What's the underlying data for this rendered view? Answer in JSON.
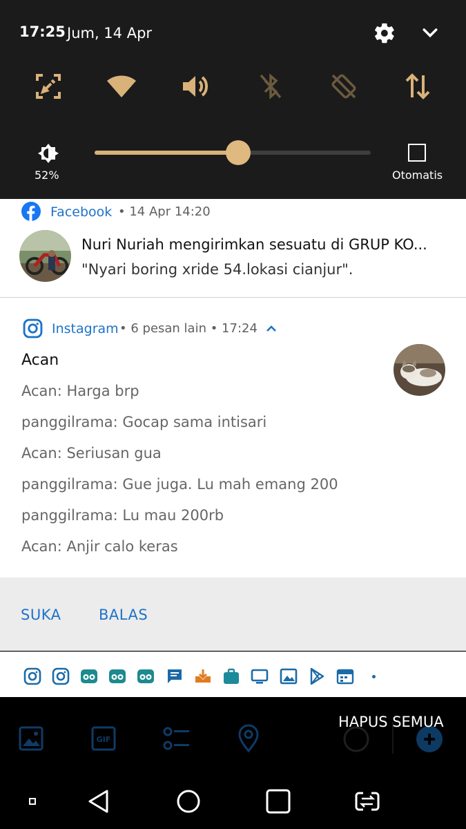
{
  "status": {
    "time": "17:25",
    "date": "Jum, 14 Apr"
  },
  "quick_settings": {
    "tiles": [
      "screenshot-edit",
      "wifi",
      "sound",
      "bluetooth-off",
      "auto-rotate-off",
      "mobile-data"
    ],
    "brightness_percent_label": "52%",
    "brightness_level": 0.52,
    "auto_label": "Otomatis",
    "accent_color": "#d9b27a"
  },
  "facebook": {
    "app": "Facebook",
    "meta": "• 14 Apr 14:20",
    "title": "Nuri Nuriah mengirimkan sesuatu di GRUP KO...",
    "text": "\"Nyari boring xride 54.lokasi cianjur\"."
  },
  "instagram": {
    "app": "Instagram",
    "meta": "• 6 pesan lain • 17:24",
    "sender": "Acan",
    "messages": [
      "Acan: Harga brp",
      "panggilrama: Gocap sama intisari",
      "Acan: Seriusan gua",
      "panggilrama: Gue juga. Lu mah emang 200",
      "panggilrama: Lu mau 200rb",
      "Acan: Anjir calo keras"
    ],
    "actions": {
      "like": "SUKA",
      "reply": "BALAS"
    }
  },
  "icon_strip": [
    "instagram",
    "instagram",
    "tripadvisor",
    "tripadvisor",
    "tripadvisor",
    "message",
    "download",
    "briefcase",
    "monitor",
    "image",
    "play-store",
    "calendar",
    "dot"
  ],
  "clear_all": "HAPUS SEMUA",
  "nav": [
    "recent-dot",
    "back",
    "home",
    "overview",
    "switch"
  ]
}
